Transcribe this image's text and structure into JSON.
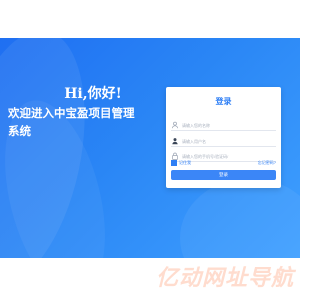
{
  "welcome": {
    "greeting": "Hi,你好!",
    "line1": "欢迎进入中宝盈项目管理",
    "line2": "系统"
  },
  "login": {
    "title": "登录",
    "username_placeholder": "请输入您的名称",
    "password_placeholder": "请输入用户名",
    "code_placeholder": "请输入您的手机号/验证码/",
    "remember_label": "记住我",
    "forgot_label": "忘记密码?",
    "submit_label": "登录"
  },
  "colors": {
    "primary": "#2f7ff5",
    "hero_start": "#1f6ff2",
    "hero_end": "#3fa0ff"
  },
  "watermark": {
    "text": "亿动网址导航"
  }
}
